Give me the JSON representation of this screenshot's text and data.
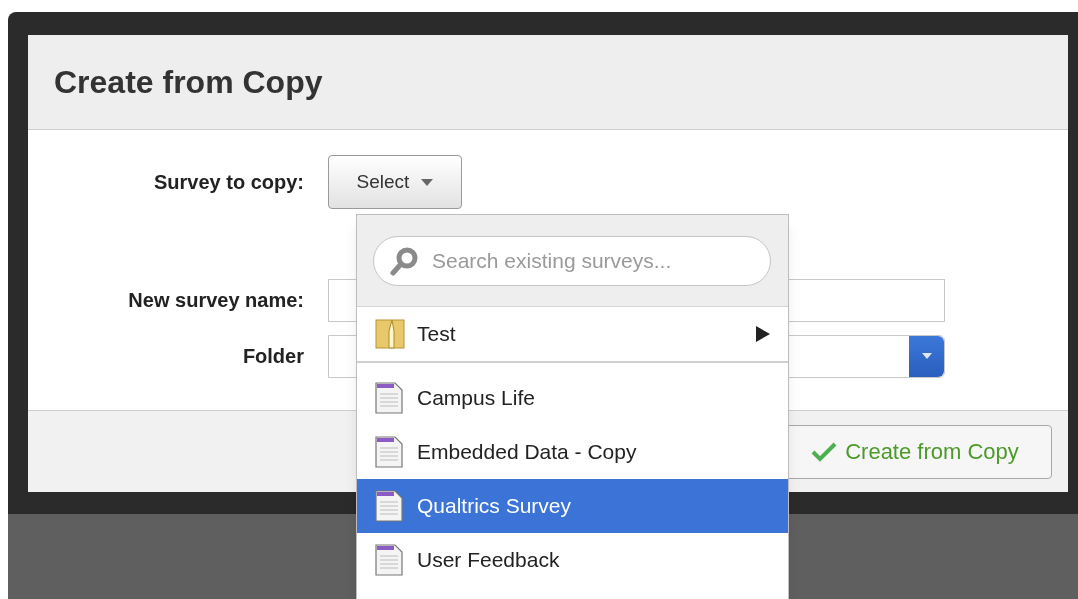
{
  "dialog": {
    "title": "Create from Copy",
    "fields": [
      {
        "label": "Survey to copy:",
        "kind": "select",
        "value": "Select"
      },
      {
        "label": "New survey name:",
        "kind": "text"
      },
      {
        "label": "Folder",
        "kind": "dropdown"
      }
    ],
    "submit": "Create from Copy"
  },
  "menu": {
    "search": {
      "placeholder": "Search existing surveys..."
    },
    "folders": [
      {
        "label": "Test"
      }
    ],
    "surveys": [
      {
        "label": "Campus Life",
        "selected": false
      },
      {
        "label": "Embedded Data - Copy",
        "selected": false
      },
      {
        "label": "Qualtrics Survey",
        "selected": true
      },
      {
        "label": "User Feedback",
        "selected": false
      }
    ]
  }
}
